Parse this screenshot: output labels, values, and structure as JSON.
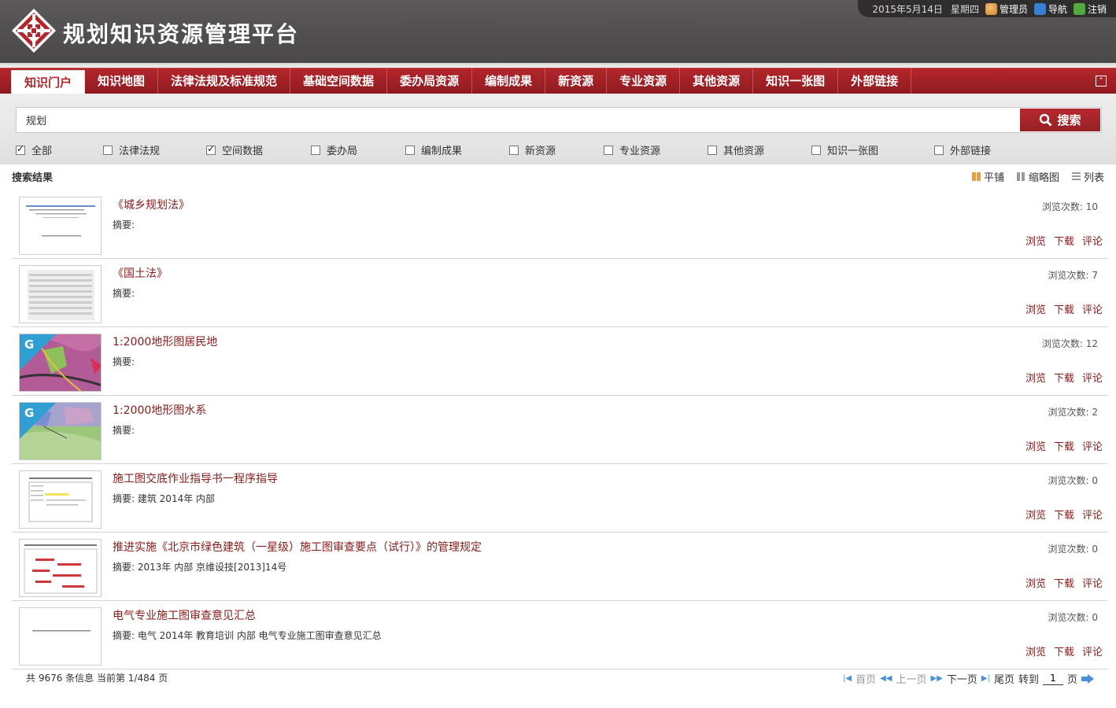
{
  "header": {
    "title": "规划知识资源管理平台",
    "date": "2015年5月14日",
    "weekday": "星期四",
    "user_label": "管理员",
    "nav_label": "导航",
    "logout_label": "注销"
  },
  "nav": {
    "items": [
      "知识门户",
      "知识地图",
      "法律法规及标准规范",
      "基础空间数据",
      "委办局资源",
      "编制成果",
      "新资源",
      "专业资源",
      "其他资源",
      "知识一张图",
      "外部链接"
    ],
    "active_index": 0
  },
  "search": {
    "value": "规划",
    "button_label": "搜索"
  },
  "filters": [
    {
      "label": "全部",
      "checked": true
    },
    {
      "label": "法律法规",
      "checked": false
    },
    {
      "label": "空间数据",
      "checked": true
    },
    {
      "label": "委办局",
      "checked": false
    },
    {
      "label": "编制成果",
      "checked": false
    },
    {
      "label": "新资源",
      "checked": false
    },
    {
      "label": "专业资源",
      "checked": false
    },
    {
      "label": "其他资源",
      "checked": false
    },
    {
      "label": "知识一张图",
      "checked": false
    },
    {
      "label": "外部链接",
      "checked": false
    }
  ],
  "results_header": {
    "title": "搜索结果",
    "view_modes": [
      "平铺",
      "缩略图",
      "列表"
    ]
  },
  "results": [
    {
      "title": "《城乡规划法》",
      "summary": "摘要:",
      "views": "浏览次数: 10",
      "thumb": "doc",
      "spatial": false
    },
    {
      "title": "《国土法》",
      "summary": "摘要:",
      "views": "浏览次数: 7",
      "thumb": "doc-blur",
      "spatial": false
    },
    {
      "title": "1:2000地形图居民地",
      "summary": "摘要:",
      "views": "浏览次数: 12",
      "thumb": "map-pink",
      "spatial": true
    },
    {
      "title": "1:2000地形图水系",
      "summary": "摘要:",
      "views": "浏览次数: 2",
      "thumb": "map-green",
      "spatial": true
    },
    {
      "title": "施工图交底作业指导书一程序指导",
      "summary": "摘要: 建筑 2014年 内部",
      "views": "浏览次数: 0",
      "thumb": "doc-form",
      "spatial": false
    },
    {
      "title": "推进实施《北京市绿色建筑（一星级）施工图审查要点（试行）》的管理规定",
      "summary": "摘要: 2013年 内部 京维设技[2013]14号",
      "views": "浏览次数: 0",
      "thumb": "doc-red",
      "spatial": false
    },
    {
      "title": "电气专业施工图审查意见汇总",
      "summary": "摘要: 电气 2014年 教育培训 内部 电气专业施工图审查意见汇总",
      "views": "浏览次数: 0",
      "thumb": "doc-plain",
      "spatial": false
    }
  ],
  "badge_letter": "G",
  "actions": {
    "browse": "浏览",
    "download": "下载",
    "comment": "评论"
  },
  "pagination": {
    "info": "共 9676 条信息 当前第 1/484 页",
    "first": "首页",
    "prev": "上一页",
    "next": "下一页",
    "last": "尾页",
    "goto_prefix": "转到",
    "goto_value": "1",
    "goto_suffix": "页"
  },
  "colors": {
    "brand": "#a3232a",
    "link": "#8b1a1a",
    "header": "#4f4d4d"
  }
}
